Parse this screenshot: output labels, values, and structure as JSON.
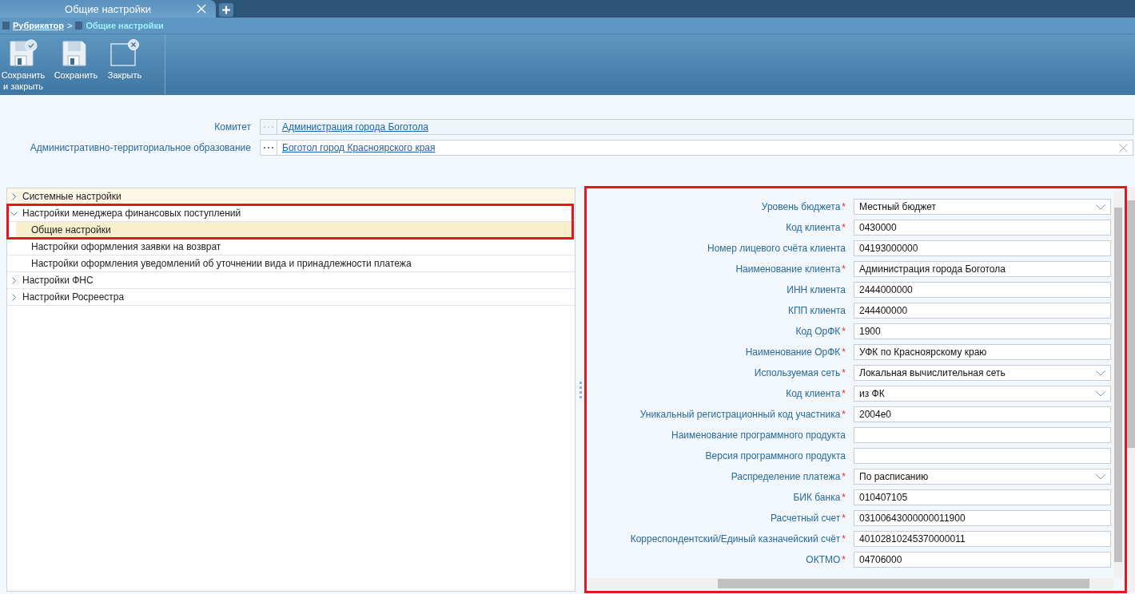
{
  "tabs": [
    {
      "label": "Общие настройки",
      "selected": true
    }
  ],
  "breadcrumb": {
    "items": [
      {
        "label": "Рубрикатор",
        "kind": "link",
        "separator": ">"
      },
      {
        "label": "Общие настройки",
        "kind": "current"
      }
    ]
  },
  "toolbar": [
    {
      "kind": "save-close",
      "label": "Сохранить\nи закрыть"
    },
    {
      "kind": "save",
      "label": "Сохранить"
    },
    {
      "kind": "close",
      "label": "Закрыть"
    }
  ],
  "header_fields": [
    {
      "label": "Комитет",
      "value": "Администрация города Боготола",
      "disabled": true,
      "clearable": false
    },
    {
      "label": "Административно-территориальное образование",
      "value": "Боготол город Красноярского края",
      "disabled": false,
      "clearable": true
    }
  ],
  "tree": [
    {
      "label": "Системные настройки",
      "expanded": false,
      "selected": false
    },
    {
      "label": "Настройки менеджера финансовых поступлений",
      "expanded": true,
      "selected": false,
      "children": [
        {
          "label": "Общие настройки",
          "selected": true
        },
        {
          "label": "Настройки оформления заявки на возврат",
          "selected": false
        },
        {
          "label": "Настройки оформления уведомлений об уточнении вида и принадлежности платежа",
          "selected": false
        }
      ]
    },
    {
      "label": "Настройки ФНС",
      "expanded": false,
      "selected": false
    },
    {
      "label": "Настройки Росреестра",
      "expanded": false,
      "selected": false
    }
  ],
  "form": [
    {
      "label": "Уровень бюджета",
      "required_mark": "*",
      "kind": "select",
      "value": "Местный бюджет"
    },
    {
      "label": "Код клиента",
      "required_mark": "*",
      "kind": "text",
      "value": "0430000"
    },
    {
      "label": "Номер лицевого счёта клиента",
      "kind": "text",
      "value": "04193000000"
    },
    {
      "label": "Наименование клиента",
      "required_mark": "*",
      "kind": "text",
      "value": "Администрация города Боготола"
    },
    {
      "label": "ИНН клиента",
      "kind": "text",
      "value": "2444000000"
    },
    {
      "label": "КПП клиента",
      "kind": "text",
      "value": "244400000"
    },
    {
      "label": "Код ОрФК",
      "required_mark": "*",
      "kind": "text",
      "value": "1900"
    },
    {
      "label": "Наименование ОрФК",
      "required_mark": "*",
      "kind": "text",
      "value": "УФК по Красноярскому краю"
    },
    {
      "label": "Используемая сеть",
      "required_mark": "*",
      "kind": "select",
      "value": "Локальная вычислительная сеть"
    },
    {
      "label": "Код клиента",
      "required_mark": "*",
      "kind": "select",
      "value": "из ФК"
    },
    {
      "label": "Уникальный регистрационный код участника",
      "required_mark": "*",
      "kind": "text",
      "value": "2004e0"
    },
    {
      "label": "Наименование программного продукта",
      "kind": "text"
    },
    {
      "label": "Версия программного продукта",
      "kind": "text"
    },
    {
      "label": "Распределение платежа",
      "required_mark": "*",
      "kind": "select",
      "value": "По расписанию"
    },
    {
      "label": "БИК банка",
      "required_mark": "*",
      "kind": "text",
      "value": "010407105"
    },
    {
      "label": "Расчетный счет",
      "required_mark": "*",
      "kind": "text",
      "value": "03100643000000011900"
    },
    {
      "label": "Корреспондентский/Единый казначейский счёт",
      "required_mark": "*",
      "kind": "text",
      "value": "40102810245370000011"
    },
    {
      "label": "ОКТМО",
      "required_mark": "*",
      "kind": "text",
      "value": "04706000"
    }
  ]
}
